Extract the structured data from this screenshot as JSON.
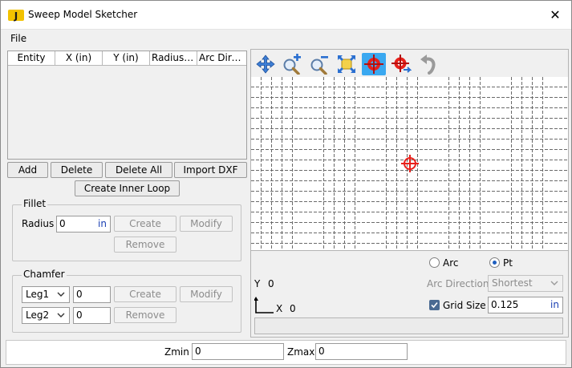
{
  "window": {
    "title": "Sweep Model Sketcher",
    "close_glyph": "✕"
  },
  "menu": {
    "file": "File"
  },
  "table": {
    "columns": [
      "Entity",
      "X (in)",
      "Y (in)",
      "Radius (i...",
      "Arc Direc..."
    ],
    "rows": []
  },
  "buttons": {
    "add": "Add",
    "delete": "Delete",
    "delete_all": "Delete All",
    "import_dxf": "Import DXF",
    "create_inner_loop": "Create Inner Loop"
  },
  "fillet": {
    "title": "Fillet",
    "radius_label": "Radius",
    "radius_value": "0",
    "radius_unit": "in",
    "create": "Create",
    "modify": "Modify",
    "remove": "Remove"
  },
  "chamfer": {
    "title": "Chamfer",
    "leg1_option": "Leg1",
    "leg1_value": "0",
    "leg2_option": "Leg2",
    "leg2_value": "0",
    "create": "Create",
    "modify": "Modify",
    "remove": "Remove"
  },
  "toolbar": {
    "icons": [
      "pan-icon",
      "zoom-in-icon",
      "zoom-out-icon",
      "zoom-fit-icon",
      "origin-target-icon",
      "move-origin-icon",
      "undo-icon"
    ],
    "active": "origin-target-icon",
    "accent_color": "#3aa8f0"
  },
  "canvas": {
    "origin_marker_color": "#e8201a"
  },
  "coords": {
    "y_label": "Y",
    "y_value": "0",
    "x_label": "X",
    "x_value": "0"
  },
  "mode": {
    "arc_label": "Arc",
    "pt_label": "Pt",
    "selected": "Pt"
  },
  "arc_direction": {
    "label": "Arc Direction",
    "value": "Shortest"
  },
  "grid": {
    "label": "Grid Size",
    "checked": true,
    "value": "0.125",
    "unit": "in"
  },
  "bottom": {
    "zmin_label": "Zmin",
    "zmin_value": "0",
    "zmax_label": "Zmax",
    "zmax_value": "0"
  }
}
